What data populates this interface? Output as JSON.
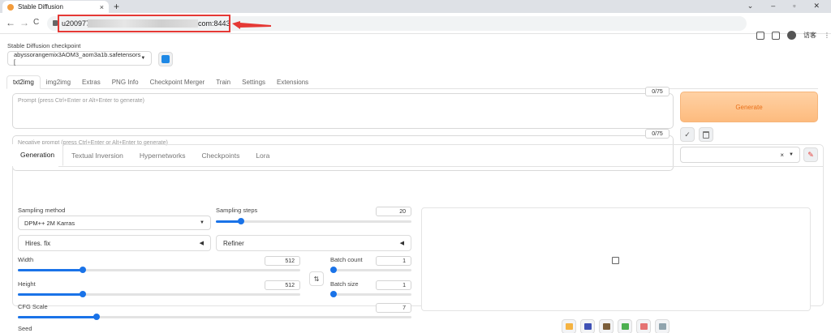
{
  "browser": {
    "tab_title": "Stable Diffusion",
    "tab_close": "×",
    "new_tab": "+",
    "window_controls": [
      "⌄",
      "–",
      "▫",
      "✕"
    ],
    "nav_back": "←",
    "nav_forward": "→",
    "nav_reload": "C",
    "url_prefix": "u200977-",
    "url_suffix": "com:8443",
    "profile_label": "访客"
  },
  "checkpoint": {
    "label": "Stable Diffusion checkpoint",
    "value": "abyssorangemix3AOM3_aom3a1b.safetensors [",
    "caret": "▼"
  },
  "main_tabs": [
    "txt2img",
    "img2img",
    "Extras",
    "PNG Info",
    "Checkpoint Merger",
    "Train",
    "Settings",
    "Extensions"
  ],
  "prompt": {
    "placeholder": "Prompt (press Ctrl+Enter or Alt+Enter to generate)",
    "counter": "0/75"
  },
  "negative_prompt": {
    "placeholder": "Negative prompt (press Ctrl+Enter or Alt+Enter to generate)",
    "counter": "0/75"
  },
  "generate_label": "Generate",
  "style_actions": {
    "apply": "✓",
    "trash": "🗑",
    "edit": "✎"
  },
  "styles_dropdown": {
    "clear": "×",
    "caret": "▼"
  },
  "gen_tabs": [
    "Generation",
    "Textual Inversion",
    "Hypernetworks",
    "Checkpoints",
    "Lora"
  ],
  "sampling_method": {
    "label": "Sampling method",
    "value": "DPM++ 2M Karras",
    "caret": "▼"
  },
  "sampling_steps": {
    "label": "Sampling steps",
    "value": "20",
    "fraction": 0.13
  },
  "hires": {
    "label": "Hires. fix",
    "icon": "◀"
  },
  "refiner": {
    "label": "Refiner",
    "icon": "◀"
  },
  "width": {
    "label": "Width",
    "value": "512",
    "fraction": 0.23
  },
  "height": {
    "label": "Height",
    "value": "512",
    "fraction": 0.23
  },
  "batch_count": {
    "label": "Batch count",
    "value": "1",
    "fraction": 0.0
  },
  "batch_size": {
    "label": "Batch size",
    "value": "1",
    "fraction": 0.0
  },
  "swap_label": "⇅",
  "cfg_scale": {
    "label": "CFG Scale",
    "value": "7",
    "fraction": 0.2
  },
  "seed": {
    "label": "Seed"
  },
  "gallery_tools": [
    {
      "name": "folder-icon",
      "color": "#f5b342"
    },
    {
      "name": "save-icon",
      "color": "#3f51b5"
    },
    {
      "name": "zip-icon",
      "color": "#7b5e3b"
    },
    {
      "name": "image-icon",
      "color": "#4caf50"
    },
    {
      "name": "palette-icon",
      "color": "#e57373"
    },
    {
      "name": "ruler-icon",
      "color": "#90a4ae"
    }
  ],
  "colors": {
    "accent": "#1a73e8",
    "generate_text": "#e8701a",
    "annotation": "#e53935"
  }
}
